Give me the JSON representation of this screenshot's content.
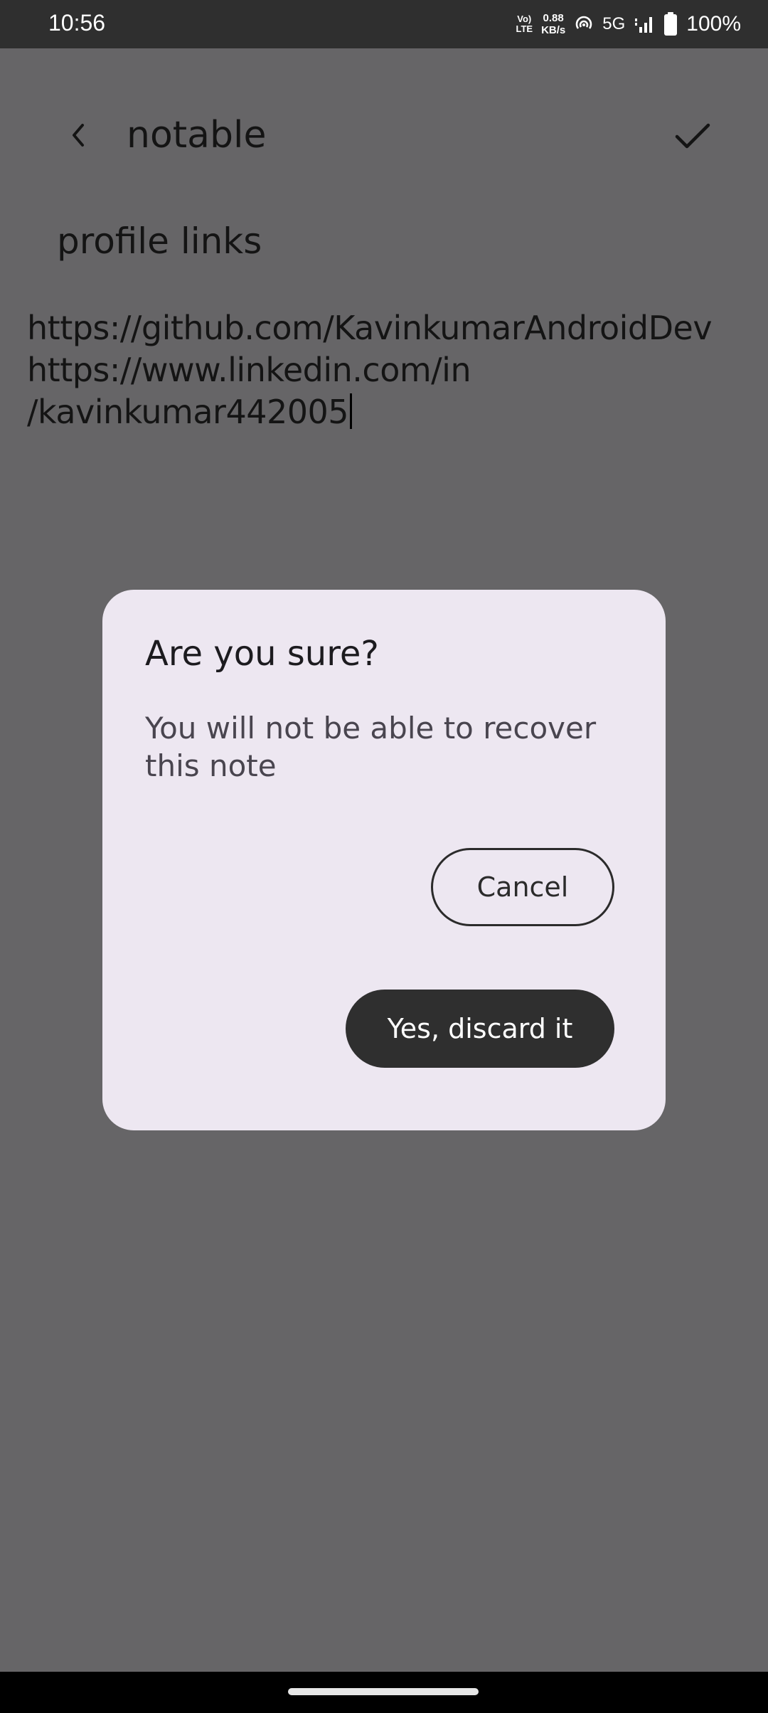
{
  "status_bar": {
    "time": "10:56",
    "volte_top": "Vo)",
    "volte_bottom": "LTE",
    "speed_value": "0.88",
    "speed_unit": "KB/s",
    "network": "5G",
    "battery_percent": "100%"
  },
  "header": {
    "title": "notable",
    "back_icon": "chevron-left-icon",
    "save_icon": "check-icon"
  },
  "note": {
    "title": "profile links",
    "body_lines": [
      "https://github.com/KavinkumarAndroidDev",
      "https://www.linkedin.com/in",
      "/kavinkumar442005"
    ]
  },
  "dialog": {
    "title": "Are you sure?",
    "message": "You will not be able to recover this note",
    "cancel_label": "Cancel",
    "confirm_label": "Yes, discard it"
  },
  "colors": {
    "scrim_background": "#666567",
    "dialog_background": "#ede7f1",
    "primary_button": "#2f2f2f"
  }
}
